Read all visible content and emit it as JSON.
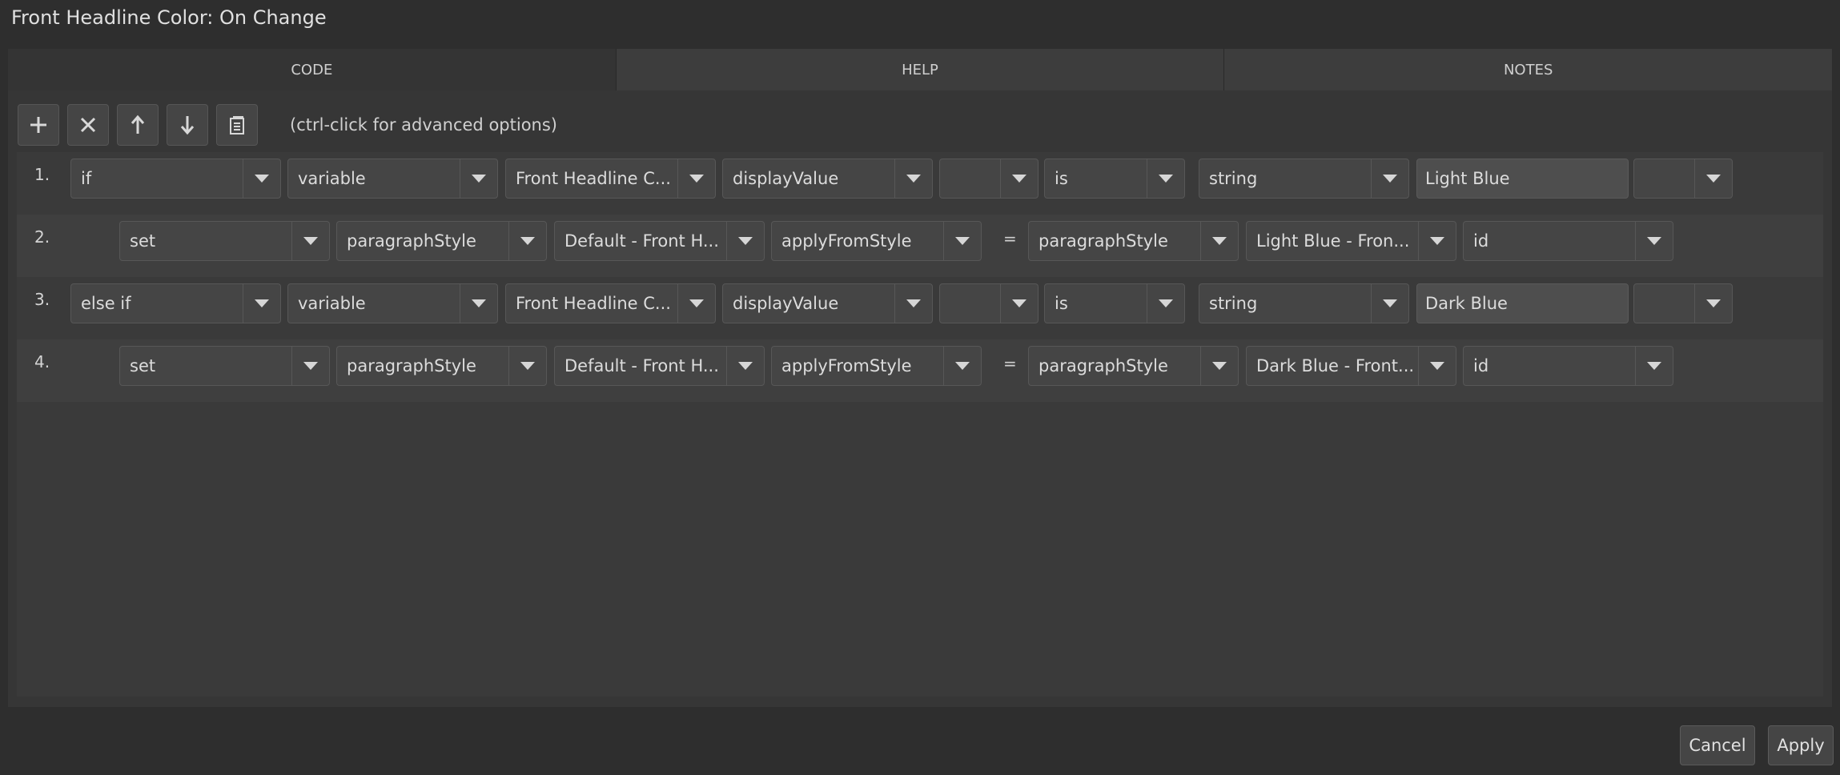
{
  "window": {
    "title": "Front Headline Color: On Change"
  },
  "tabs": [
    {
      "label": "CODE",
      "active": true
    },
    {
      "label": "HELP",
      "active": false
    },
    {
      "label": "NOTES",
      "active": false
    }
  ],
  "toolbar": {
    "buttons": [
      {
        "icon": "plus-icon"
      },
      {
        "icon": "close-icon"
      },
      {
        "icon": "arrow-up-icon"
      },
      {
        "icon": "arrow-down-icon"
      },
      {
        "icon": "clipboard-icon"
      }
    ],
    "hint": "(ctrl-click for advanced options)"
  },
  "rows": [
    {
      "num": "1.",
      "keyword": "if",
      "type": "variable",
      "target": "Front Headline C...",
      "property": "displayValue",
      "modifier": "",
      "operator": "is",
      "value_type": "string",
      "value": "Light Blue",
      "extra": ""
    },
    {
      "num": "2.",
      "keyword": "set",
      "type": "paragraphStyle",
      "target": "Default - Front H...",
      "property": "applyFromStyle",
      "eq": "=",
      "value_type": "paragraphStyle",
      "value": "Light Blue - Fron...",
      "extra": "id"
    },
    {
      "num": "3.",
      "keyword": "else if",
      "type": "variable",
      "target": "Front Headline C...",
      "property": "displayValue",
      "modifier": "",
      "operator": "is",
      "value_type": "string",
      "value": "Dark Blue",
      "extra": ""
    },
    {
      "num": "4.",
      "keyword": "set",
      "type": "paragraphStyle",
      "target": "Default - Front H...",
      "property": "applyFromStyle",
      "eq": "=",
      "value_type": "paragraphStyle",
      "value": "Dark Blue - Front...",
      "extra": "id"
    }
  ],
  "footer": {
    "cancel_label": "Cancel",
    "apply_label": "Apply"
  }
}
